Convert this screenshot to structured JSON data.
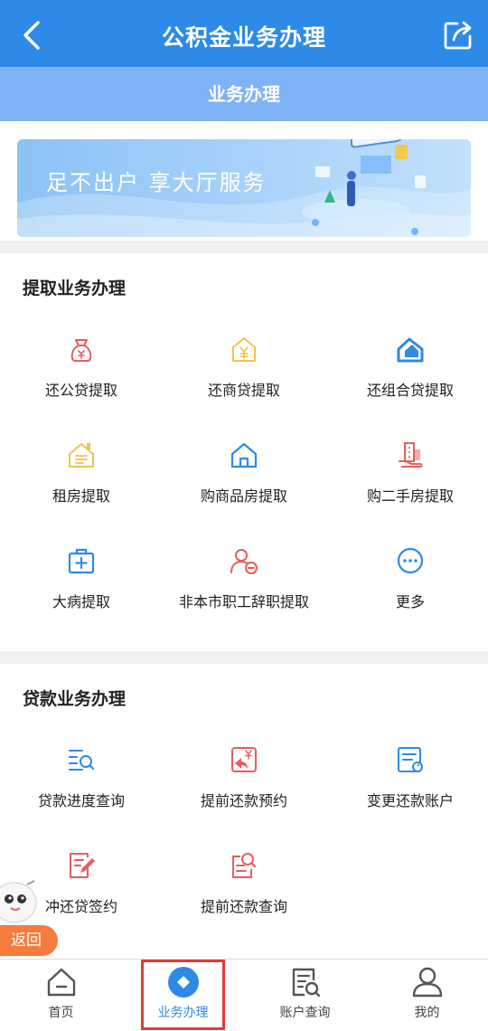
{
  "header": {
    "title": "公积金业务办理"
  },
  "subheader": {
    "title": "业务办理"
  },
  "banner": {
    "slogan": "足不出户 享大厅服务"
  },
  "withdraw_section": {
    "title": "提取业务办理",
    "items": [
      {
        "label": "还公贷提取",
        "icon": "moneybag-icon"
      },
      {
        "label": "还商贷提取",
        "icon": "house-yen-icon"
      },
      {
        "label": "还组合贷提取",
        "icon": "combo-house-icon"
      },
      {
        "label": "租房提取",
        "icon": "rent-house-icon"
      },
      {
        "label": "购商品房提取",
        "icon": "home-icon"
      },
      {
        "label": "购二手房提取",
        "icon": "building-hand-icon"
      },
      {
        "label": "大病提取",
        "icon": "medical-kit-icon"
      },
      {
        "label": "非本市职工辞职提取",
        "icon": "user-minus-icon"
      },
      {
        "label": "更多",
        "icon": "more-icon"
      }
    ]
  },
  "loan_section": {
    "title": "贷款业务办理",
    "items": [
      {
        "label": "贷款进度查询",
        "icon": "list-search-icon"
      },
      {
        "label": "提前还款预约",
        "icon": "return-yen-icon"
      },
      {
        "label": "变更还款账户",
        "icon": "card-refresh-icon"
      },
      {
        "label": "冲还贷签约",
        "icon": "sign-edit-icon"
      },
      {
        "label": "提前还款查询",
        "icon": "doc-search-icon"
      }
    ]
  },
  "floating": {
    "back_label": "返回"
  },
  "tabbar": {
    "tabs": [
      {
        "label": "首页",
        "icon": "home-tab-icon"
      },
      {
        "label": "业务办理",
        "icon": "business-diamond-icon"
      },
      {
        "label": "账户查询",
        "icon": "account-search-icon"
      },
      {
        "label": "我的",
        "icon": "profile-icon"
      }
    ],
    "active_index": 1
  },
  "colors": {
    "primary": "#2d8ae7",
    "accent_red": "#e85d5d",
    "accent_yellow": "#f2c14e",
    "highlight_frame": "#e53935"
  }
}
